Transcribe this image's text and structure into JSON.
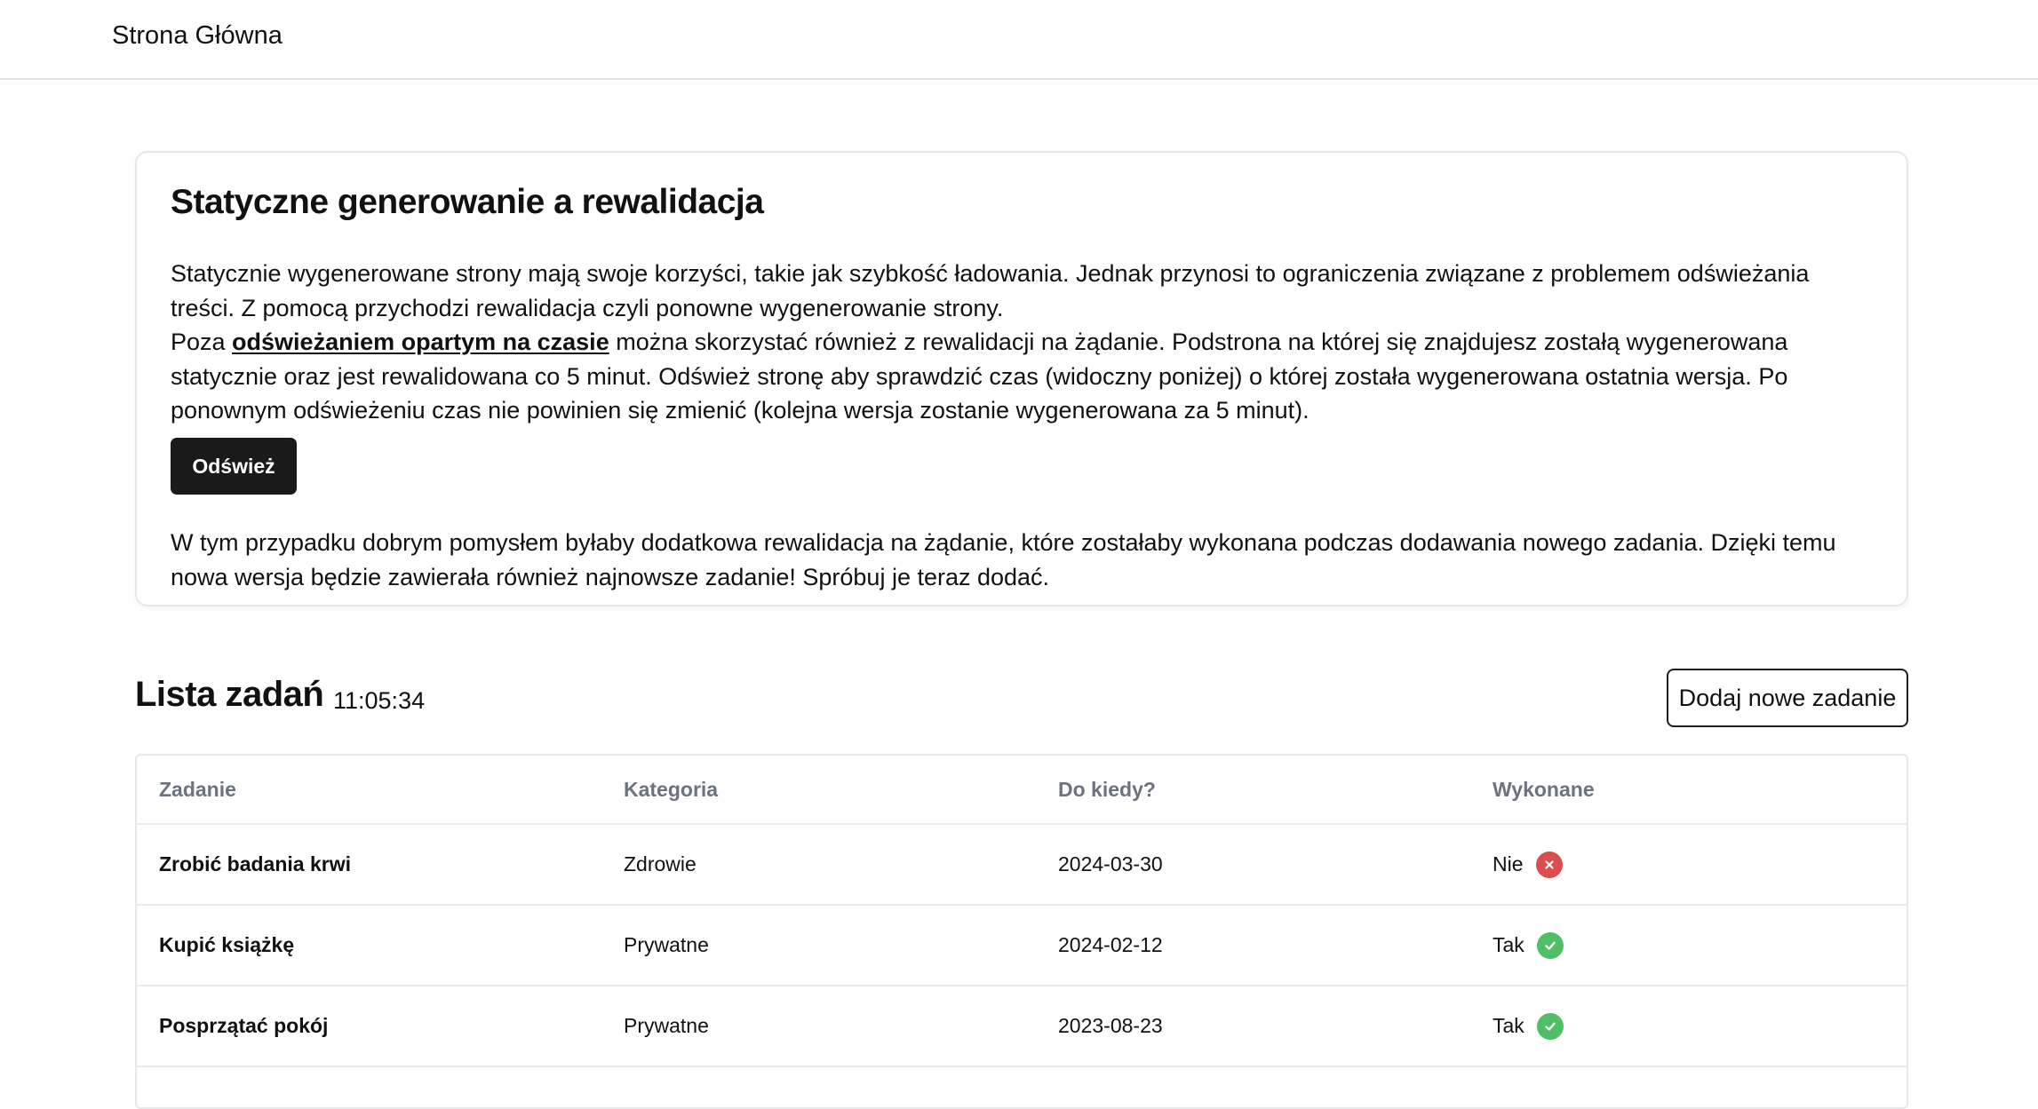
{
  "nav": {
    "home_label": "Strona Główna"
  },
  "info_card": {
    "title": "Statyczne generowanie a rewalidacja",
    "para1_a": "Statycznie wygenerowane strony mają swoje korzyści, takie jak szybkość ładowania. Jednak przynosi to ograniczenia związane z problemem odświeżania treści. Z pomocą przychodzi rewalidacja czyli ponowne wygenerowanie strony.",
    "para1_b": "Poza ",
    "para1_link": "odświeżaniem opartym na czasie",
    "para1_c": " można skorzystać również z rewalidacji na żądanie. Podstrona na której się znajdujesz zostałą wygenerowana statycznie oraz jest rewalidowana co 5 minut. Odśwież stronę aby sprawdzić czas (widoczny poniżej) o której została wygenerowana ostatnia wersja. Po ponownym odświeżeniu czas nie powinien się zmienić (kolejna wersja zostanie wygenerowana za 5 minut).",
    "refresh_button": "Odśwież",
    "para2": "W tym przypadku dobrym pomysłem byłaby dodatkowa rewalidacja na żądanie, które zostałaby wykonana podczas dodawania nowego zadania. Dzięki temu nowa wersja będzie zawierała również najnowsze zadanie! Spróbuj je teraz dodać."
  },
  "task_list": {
    "title": "Lista zadań",
    "generated_time": "11:05:34",
    "add_button": "Dodaj nowe zadanie",
    "columns": [
      "Zadanie",
      "Kategoria",
      "Do kiedy?",
      "Wykonane"
    ],
    "rows": [
      {
        "task": "Zrobić badania krwi",
        "category": "Zdrowie",
        "due": "2024-03-30",
        "done": "Nie",
        "done_icon": "x-circle-icon"
      },
      {
        "task": "Kupić książkę",
        "category": "Prywatne",
        "due": "2024-02-12",
        "done": "Tak",
        "done_icon": "check-circle-icon"
      },
      {
        "task": "Posprzątać pokój",
        "category": "Prywatne",
        "due": "2023-08-23",
        "done": "Tak",
        "done_icon": "check-circle-icon"
      }
    ]
  },
  "colors": {
    "status_no": "#dc4d4d",
    "status_yes": "#4fbe64",
    "primary_button": "#1a1a1a"
  }
}
